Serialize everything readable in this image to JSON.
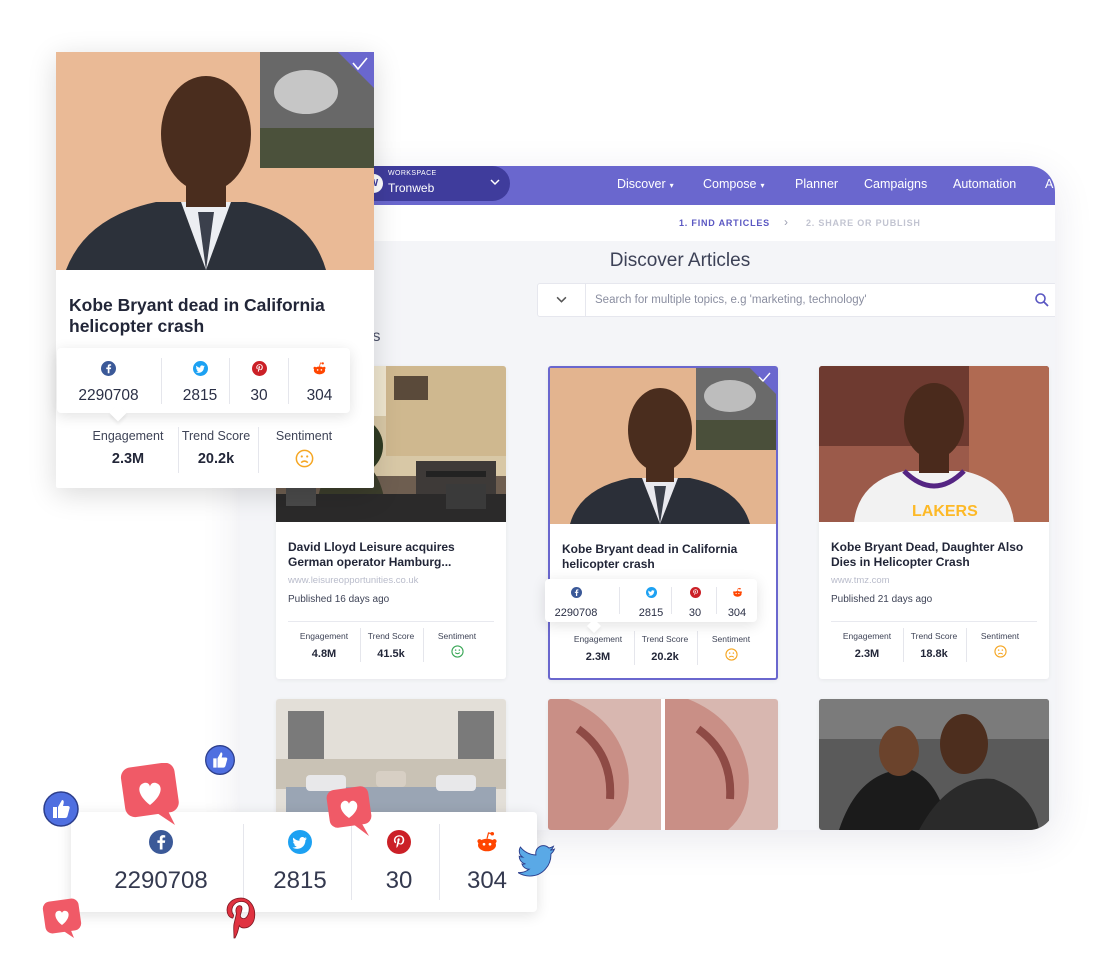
{
  "nav": {
    "workspace_label": "WORKSPACE",
    "workspace_name": "Tronweb",
    "items": [
      "Discover",
      "Compose",
      "Planner",
      "Campaigns",
      "Automation",
      "A"
    ]
  },
  "steps": {
    "step1": "1. FIND ARTICLES",
    "step2": "2. SHARE OR PUBLISH"
  },
  "main": {
    "title": "Discover Articles",
    "search_placeholder": "Search for multiple topics, e.g 'marketing, technology'",
    "section_heading": "cles"
  },
  "metric_labels": {
    "engagement": "Engagement",
    "trend": "Trend Score",
    "sentiment": "Sentiment"
  },
  "cards": [
    {
      "title": "David Lloyd Leisure acquires German operator Hamburg...",
      "url": "www.leisureopportunities.co.uk",
      "published": "Published 16 days ago",
      "engagement": "4.8M",
      "trend": "41.5k",
      "sentiment": "positive"
    },
    {
      "title": "Kobe Bryant dead in California helicopter crash",
      "engagement": "2.3M",
      "trend": "20.2k",
      "sentiment": "negative",
      "social": {
        "facebook": "2290708",
        "twitter": "2815",
        "pinterest": "30",
        "reddit": "304"
      }
    },
    {
      "title": "Kobe Bryant Dead, Daughter Also Dies in Helicopter Crash",
      "url": "www.tmz.com",
      "published": "Published 21 days ago",
      "engagement": "2.3M",
      "trend": "18.8k",
      "sentiment": "negative"
    }
  ],
  "popup": {
    "title": "Kobe Bryant dead in California helicopter crash",
    "social": {
      "facebook": "2290708",
      "twitter": "2815",
      "pinterest": "30",
      "reddit": "304"
    },
    "engagement": "2.3M",
    "trend": "20.2k",
    "sentiment": "negative"
  },
  "big_social": {
    "facebook": "2290708",
    "twitter": "2815",
    "pinterest": "30",
    "reddit": "304"
  },
  "colors": {
    "accent": "#6a67ce",
    "workspace": "#3f3c9c",
    "facebook": "#3b5998",
    "twitter": "#1da1f2",
    "pinterest": "#cb2027",
    "reddit": "#ff4500",
    "heart": "#f0505e",
    "sentiment_negative": "#f5a623",
    "sentiment_positive": "#3aa757"
  }
}
